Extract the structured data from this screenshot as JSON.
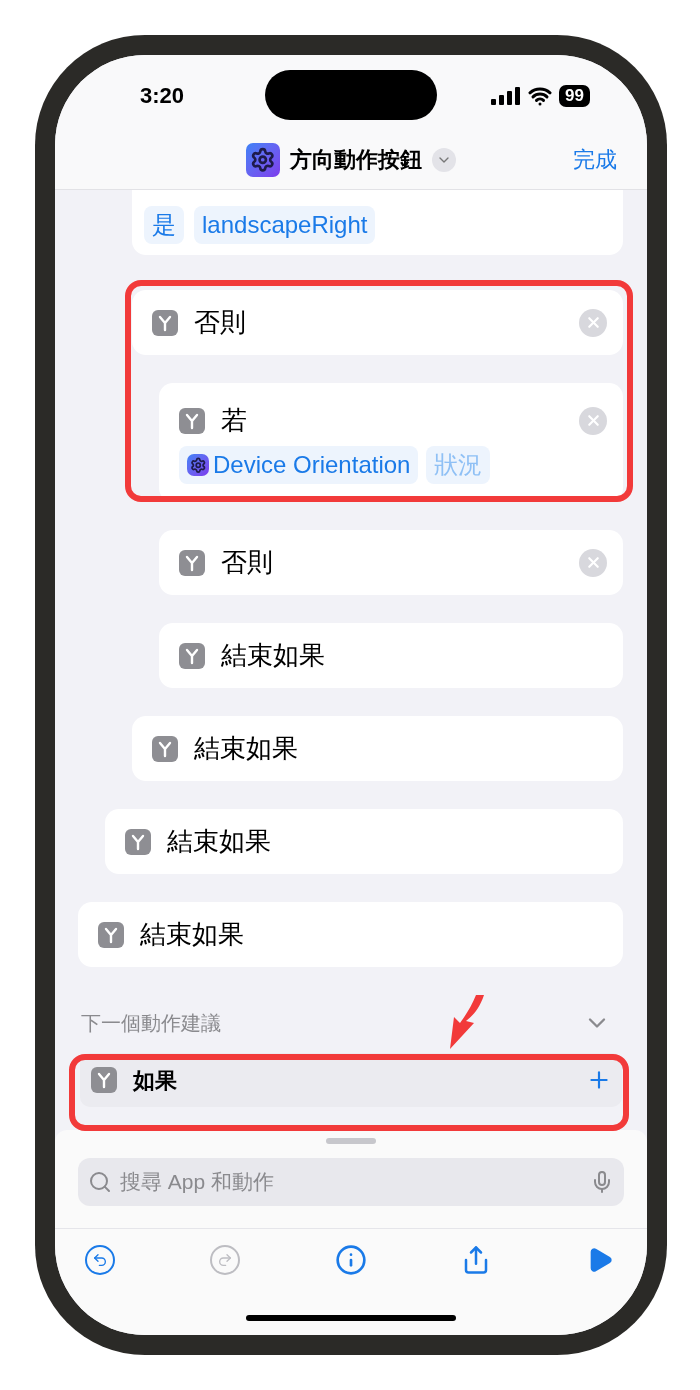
{
  "status_bar": {
    "time": "3:20",
    "battery": "99"
  },
  "nav": {
    "title": "方向動作按鈕",
    "done": "完成"
  },
  "blocks": [
    {
      "kind": "scope",
      "children": [
        {
          "kind": "scope",
          "children": [
            {
              "kind": "partial",
              "tokens": [
                {
                  "text": "是",
                  "kind": "value"
                },
                {
                  "text": "landscapeRight",
                  "kind": "value"
                }
              ]
            },
            {
              "kind": "action",
              "label": "否則",
              "removable": true,
              "children": [
                {
                  "kind": "action",
                  "label": "若",
                  "removable": true,
                  "tokens": [
                    {
                      "text": "Device Orientation",
                      "kind": "variable"
                    },
                    {
                      "text": "狀況",
                      "kind": "placeholder"
                    }
                  ]
                },
                {
                  "kind": "action",
                  "label": "否則",
                  "removable": true
                },
                {
                  "kind": "action",
                  "label": "結束如果",
                  "removable": false
                }
              ]
            },
            {
              "kind": "action",
              "label": "結束如果",
              "removable": false
            }
          ]
        },
        {
          "kind": "action",
          "label": "結束如果",
          "removable": false
        }
      ]
    },
    {
      "kind": "action",
      "label": "結束如果",
      "removable": false
    }
  ],
  "suggestions": {
    "title": "下一個動作建議",
    "items": [
      {
        "label": "如果"
      }
    ]
  },
  "search": {
    "placeholder": "搜尋 App 和動作"
  }
}
